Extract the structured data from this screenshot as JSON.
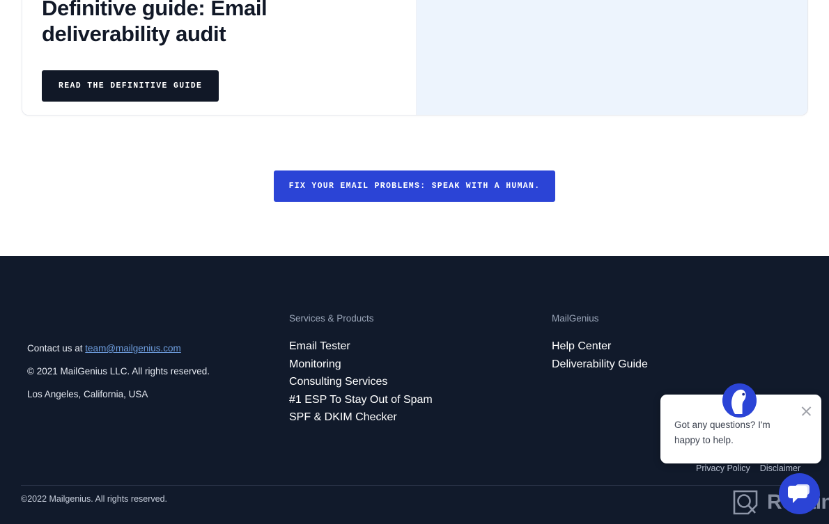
{
  "promo": {
    "title": "Definitive guide: Email deliverability audit",
    "button_label": "READ THE DEFINITIVE GUIDE"
  },
  "cta": {
    "label": "FIX YOUR EMAIL PROBLEMS: SPEAK WITH A HUMAN."
  },
  "footer": {
    "contact": {
      "prefix": "Contact us at ",
      "email": "team@mailgenius.com",
      "copyright": "© 2021 MailGenius LLC. All rights reserved.",
      "address": "Los Angeles, California, USA"
    },
    "services": {
      "heading": "Services & Products",
      "links": [
        "Email Tester",
        "Monitoring",
        "Consulting Services",
        "#1 ESP To Stay Out of Spam",
        "SPF & DKIM Checker"
      ]
    },
    "mailgenius": {
      "heading": "MailGenius",
      "links": [
        "Help Center",
        "Deliverability Guide"
      ]
    },
    "bottom_copyright": "©2022 Mailgenius. All rights reserved."
  },
  "chat": {
    "message": "Got any questions? I'm happy to help.",
    "close_icon": "close-icon",
    "avatar_icon": "mailgenius-llama-avatar-icon",
    "launcher_icon": "chat-bubbles-icon"
  },
  "legal": {
    "privacy": "Privacy Policy",
    "disclaimer": "Disclaimer"
  },
  "watermark": {
    "text": "Revain",
    "icon": "revain-logo-icon"
  },
  "colors": {
    "accent_blue": "#2b44d6",
    "dark": "#111827",
    "footer_bg": "#111a2b",
    "panel_blue": "#edf4fd",
    "link_blue": "#6f9fe0"
  }
}
